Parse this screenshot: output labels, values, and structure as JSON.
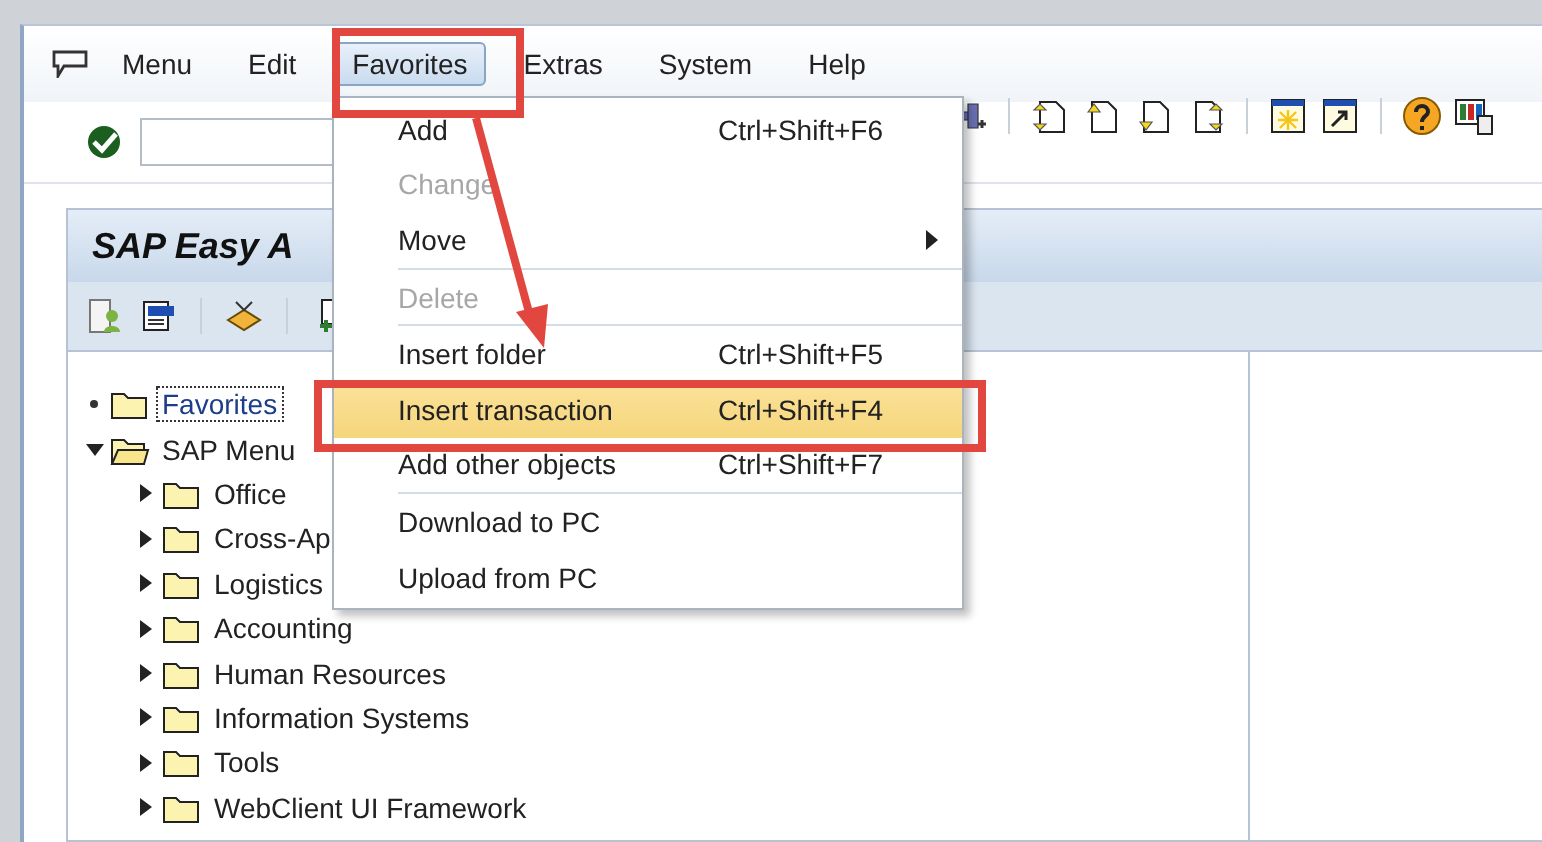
{
  "menu_bar": [
    {
      "label": "Menu",
      "selected": false
    },
    {
      "label": "Edit",
      "selected": false
    },
    {
      "label": "Favorites",
      "selected": true
    },
    {
      "label": "Extras",
      "selected": false
    },
    {
      "label": "System",
      "selected": false
    },
    {
      "label": "Help",
      "selected": false
    }
  ],
  "panel": {
    "title": "SAP Easy A"
  },
  "tree": [
    {
      "label": "Favorites",
      "kind": "leaf",
      "selected": true
    },
    {
      "label": "SAP Menu",
      "kind": "folder",
      "selected": false,
      "expanded": true,
      "children": [
        {
          "label": "Office",
          "kind": "folder",
          "selected": false,
          "expanded": false
        },
        {
          "label": "Cross-Ap",
          "kind": "folder",
          "selected": false,
          "expanded": false
        },
        {
          "label": "Logistics",
          "kind": "folder",
          "selected": false,
          "expanded": false
        },
        {
          "label": "Accounting",
          "kind": "folder",
          "selected": false,
          "expanded": false
        },
        {
          "label": "Human Resources",
          "kind": "folder",
          "selected": false,
          "expanded": false
        },
        {
          "label": "Information Systems",
          "kind": "folder",
          "selected": false,
          "expanded": false
        },
        {
          "label": "Tools",
          "kind": "folder",
          "selected": false,
          "expanded": false
        },
        {
          "label": "WebClient UI Framework",
          "kind": "folder",
          "selected": false,
          "expanded": false
        }
      ]
    }
  ],
  "favorites_menu": [
    {
      "kind": "item",
      "label": "Add",
      "shortcut": "Ctrl+Shift+F6",
      "disabled": false,
      "selected": false,
      "submenu": false
    },
    {
      "kind": "item",
      "label": "Change",
      "disabled": true,
      "selected": false,
      "submenu": false
    },
    {
      "kind": "item",
      "label": "Move",
      "disabled": false,
      "selected": false,
      "submenu": true
    },
    {
      "kind": "separator"
    },
    {
      "kind": "item",
      "label": "Delete",
      "disabled": true,
      "selected": false,
      "submenu": false
    },
    {
      "kind": "separator"
    },
    {
      "kind": "item",
      "label": "Insert folder",
      "shortcut": "Ctrl+Shift+F5",
      "disabled": false,
      "selected": false,
      "submenu": false
    },
    {
      "kind": "item",
      "label": "Insert transaction",
      "shortcut": "Ctrl+Shift+F4",
      "disabled": false,
      "selected": true,
      "submenu": false
    },
    {
      "kind": "item",
      "label": "Add other objects",
      "shortcut": "Ctrl+Shift+F7",
      "disabled": false,
      "selected": false,
      "submenu": false
    },
    {
      "kind": "separator"
    },
    {
      "kind": "item",
      "label": "Download to PC",
      "disabled": false,
      "selected": false,
      "submenu": false
    },
    {
      "kind": "item",
      "label": "Upload from PC",
      "disabled": false,
      "selected": false,
      "submenu": false
    }
  ]
}
